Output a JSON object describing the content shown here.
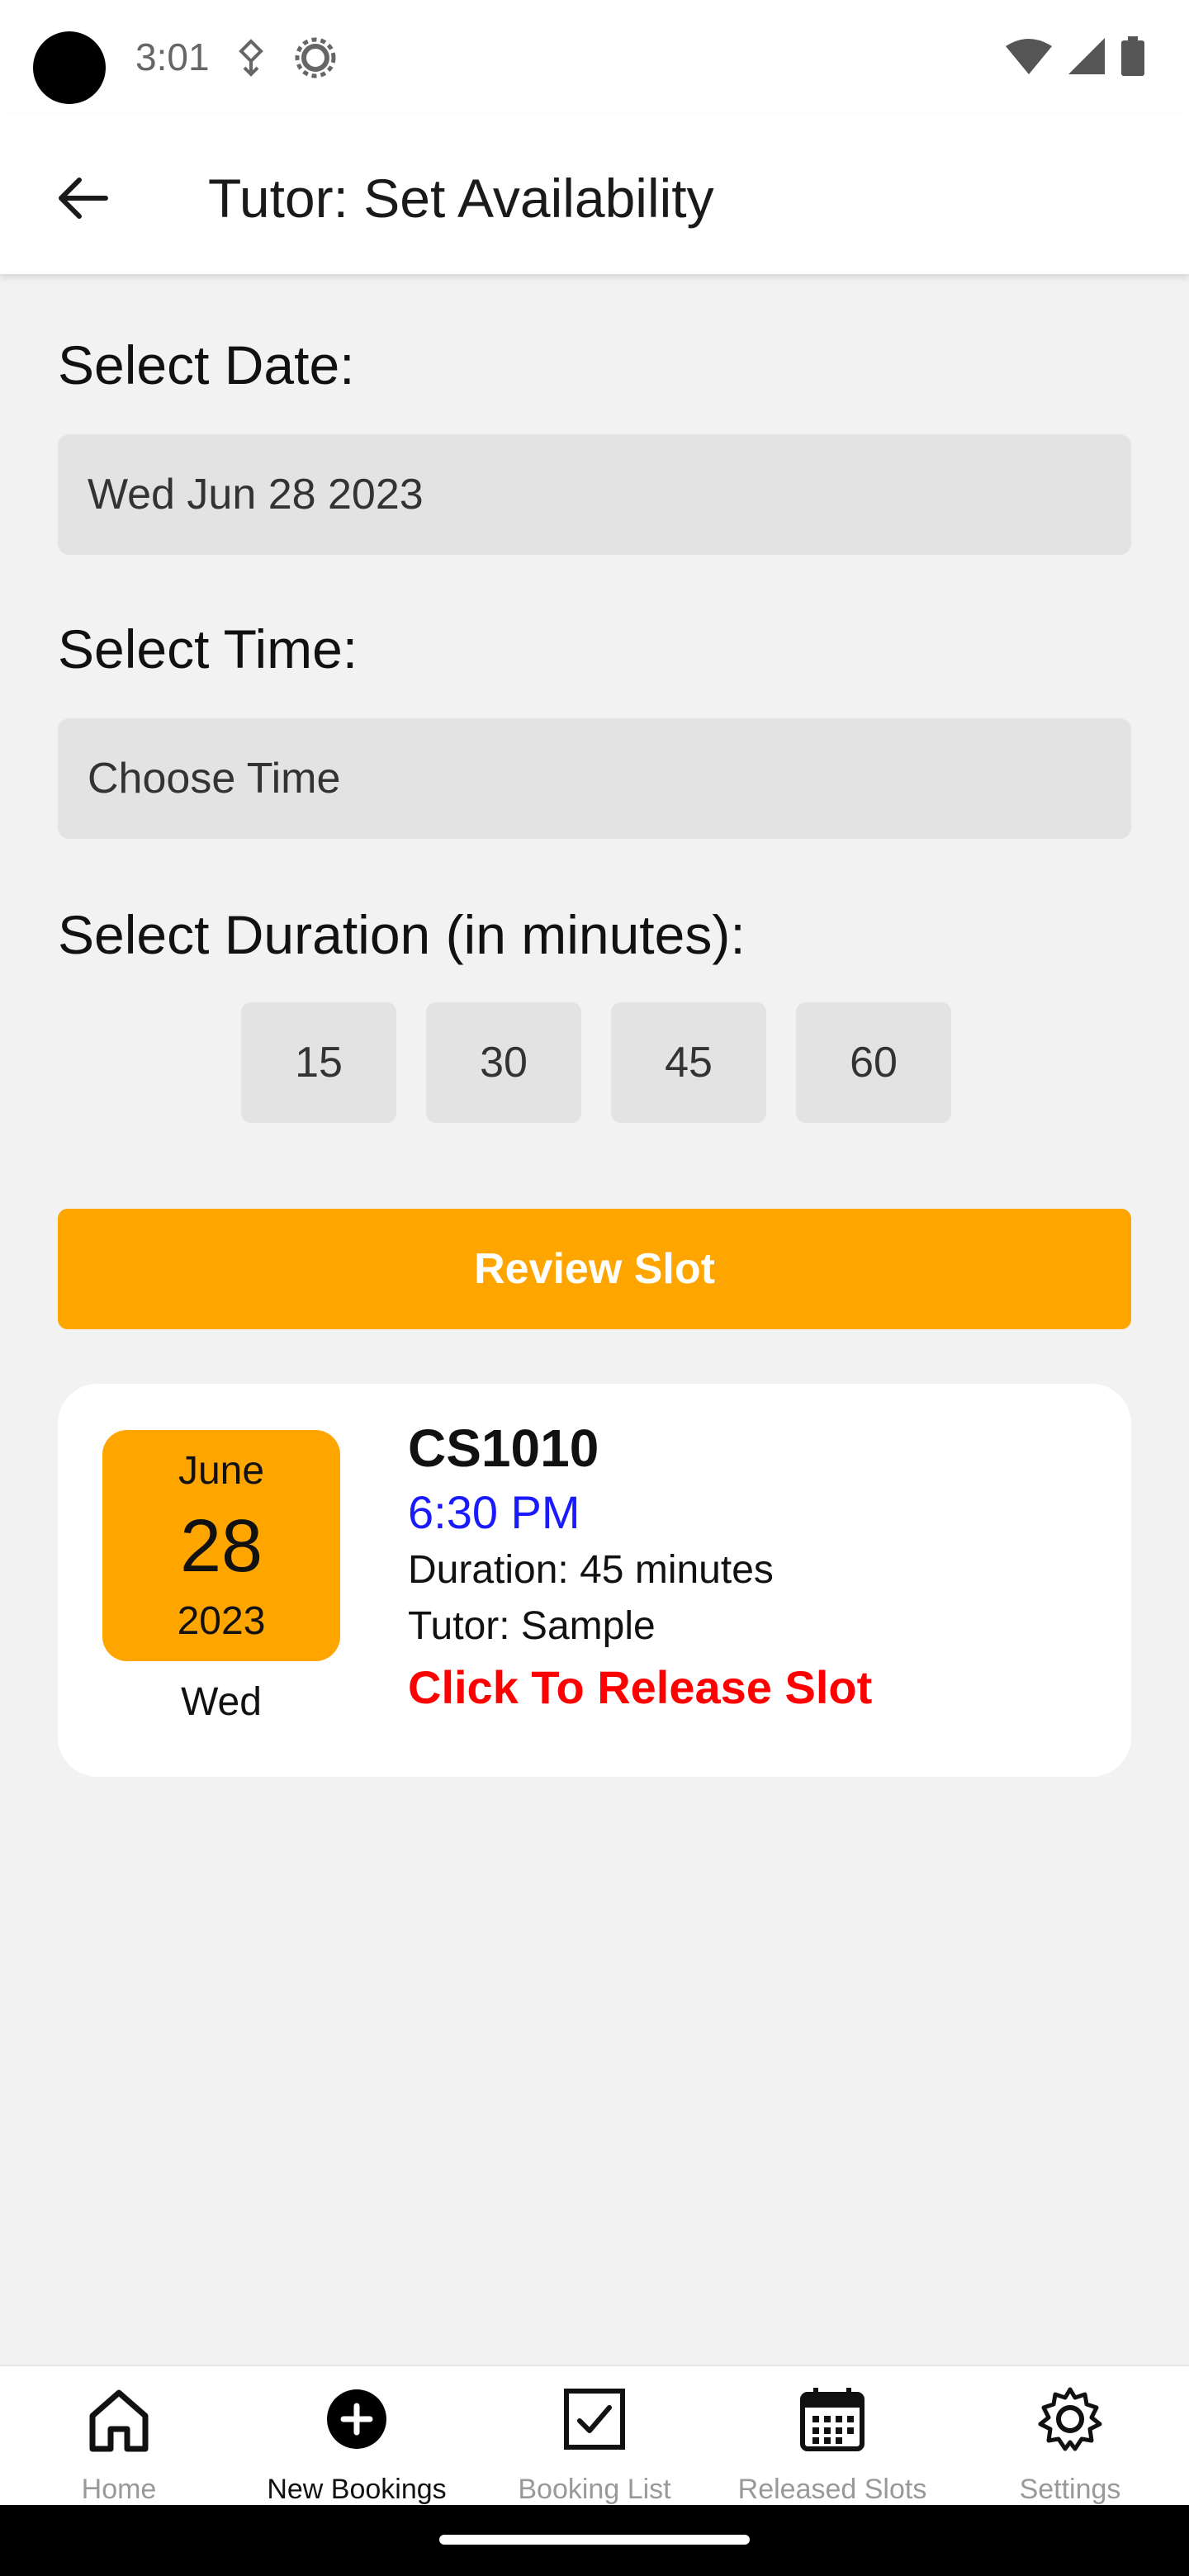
{
  "status_bar": {
    "time": "3:01"
  },
  "app_bar": {
    "title": "Tutor: Set Availability"
  },
  "form": {
    "date_label": "Select Date:",
    "date_value": "Wed Jun 28 2023",
    "time_label": "Select Time:",
    "time_value": "Choose Time",
    "duration_label": "Select Duration (in minutes):",
    "durations": [
      "15",
      "30",
      "45",
      "60"
    ],
    "review_button": "Review Slot"
  },
  "slot": {
    "month": "June",
    "day": "28",
    "year": "2023",
    "weekday": "Wed",
    "course": "CS1010",
    "time": "6:30 PM",
    "duration": "Duration: 45 minutes",
    "tutor": "Tutor: Sample",
    "release": "Click To Release Slot"
  },
  "bottom_nav": {
    "items": [
      {
        "label": "Home",
        "icon": "home-icon"
      },
      {
        "label": "New Bookings",
        "icon": "add-circle-icon"
      },
      {
        "label": "Booking List",
        "icon": "checkbox-icon"
      },
      {
        "label": "Released Slots",
        "icon": "calendar-icon"
      },
      {
        "label": "Settings",
        "icon": "gear-icon"
      }
    ],
    "active_index": 1
  },
  "colors": {
    "accent": "#ffa500",
    "time_blue": "#1a1aff",
    "release_red": "#ff0000",
    "background": "#f2f2f2"
  }
}
